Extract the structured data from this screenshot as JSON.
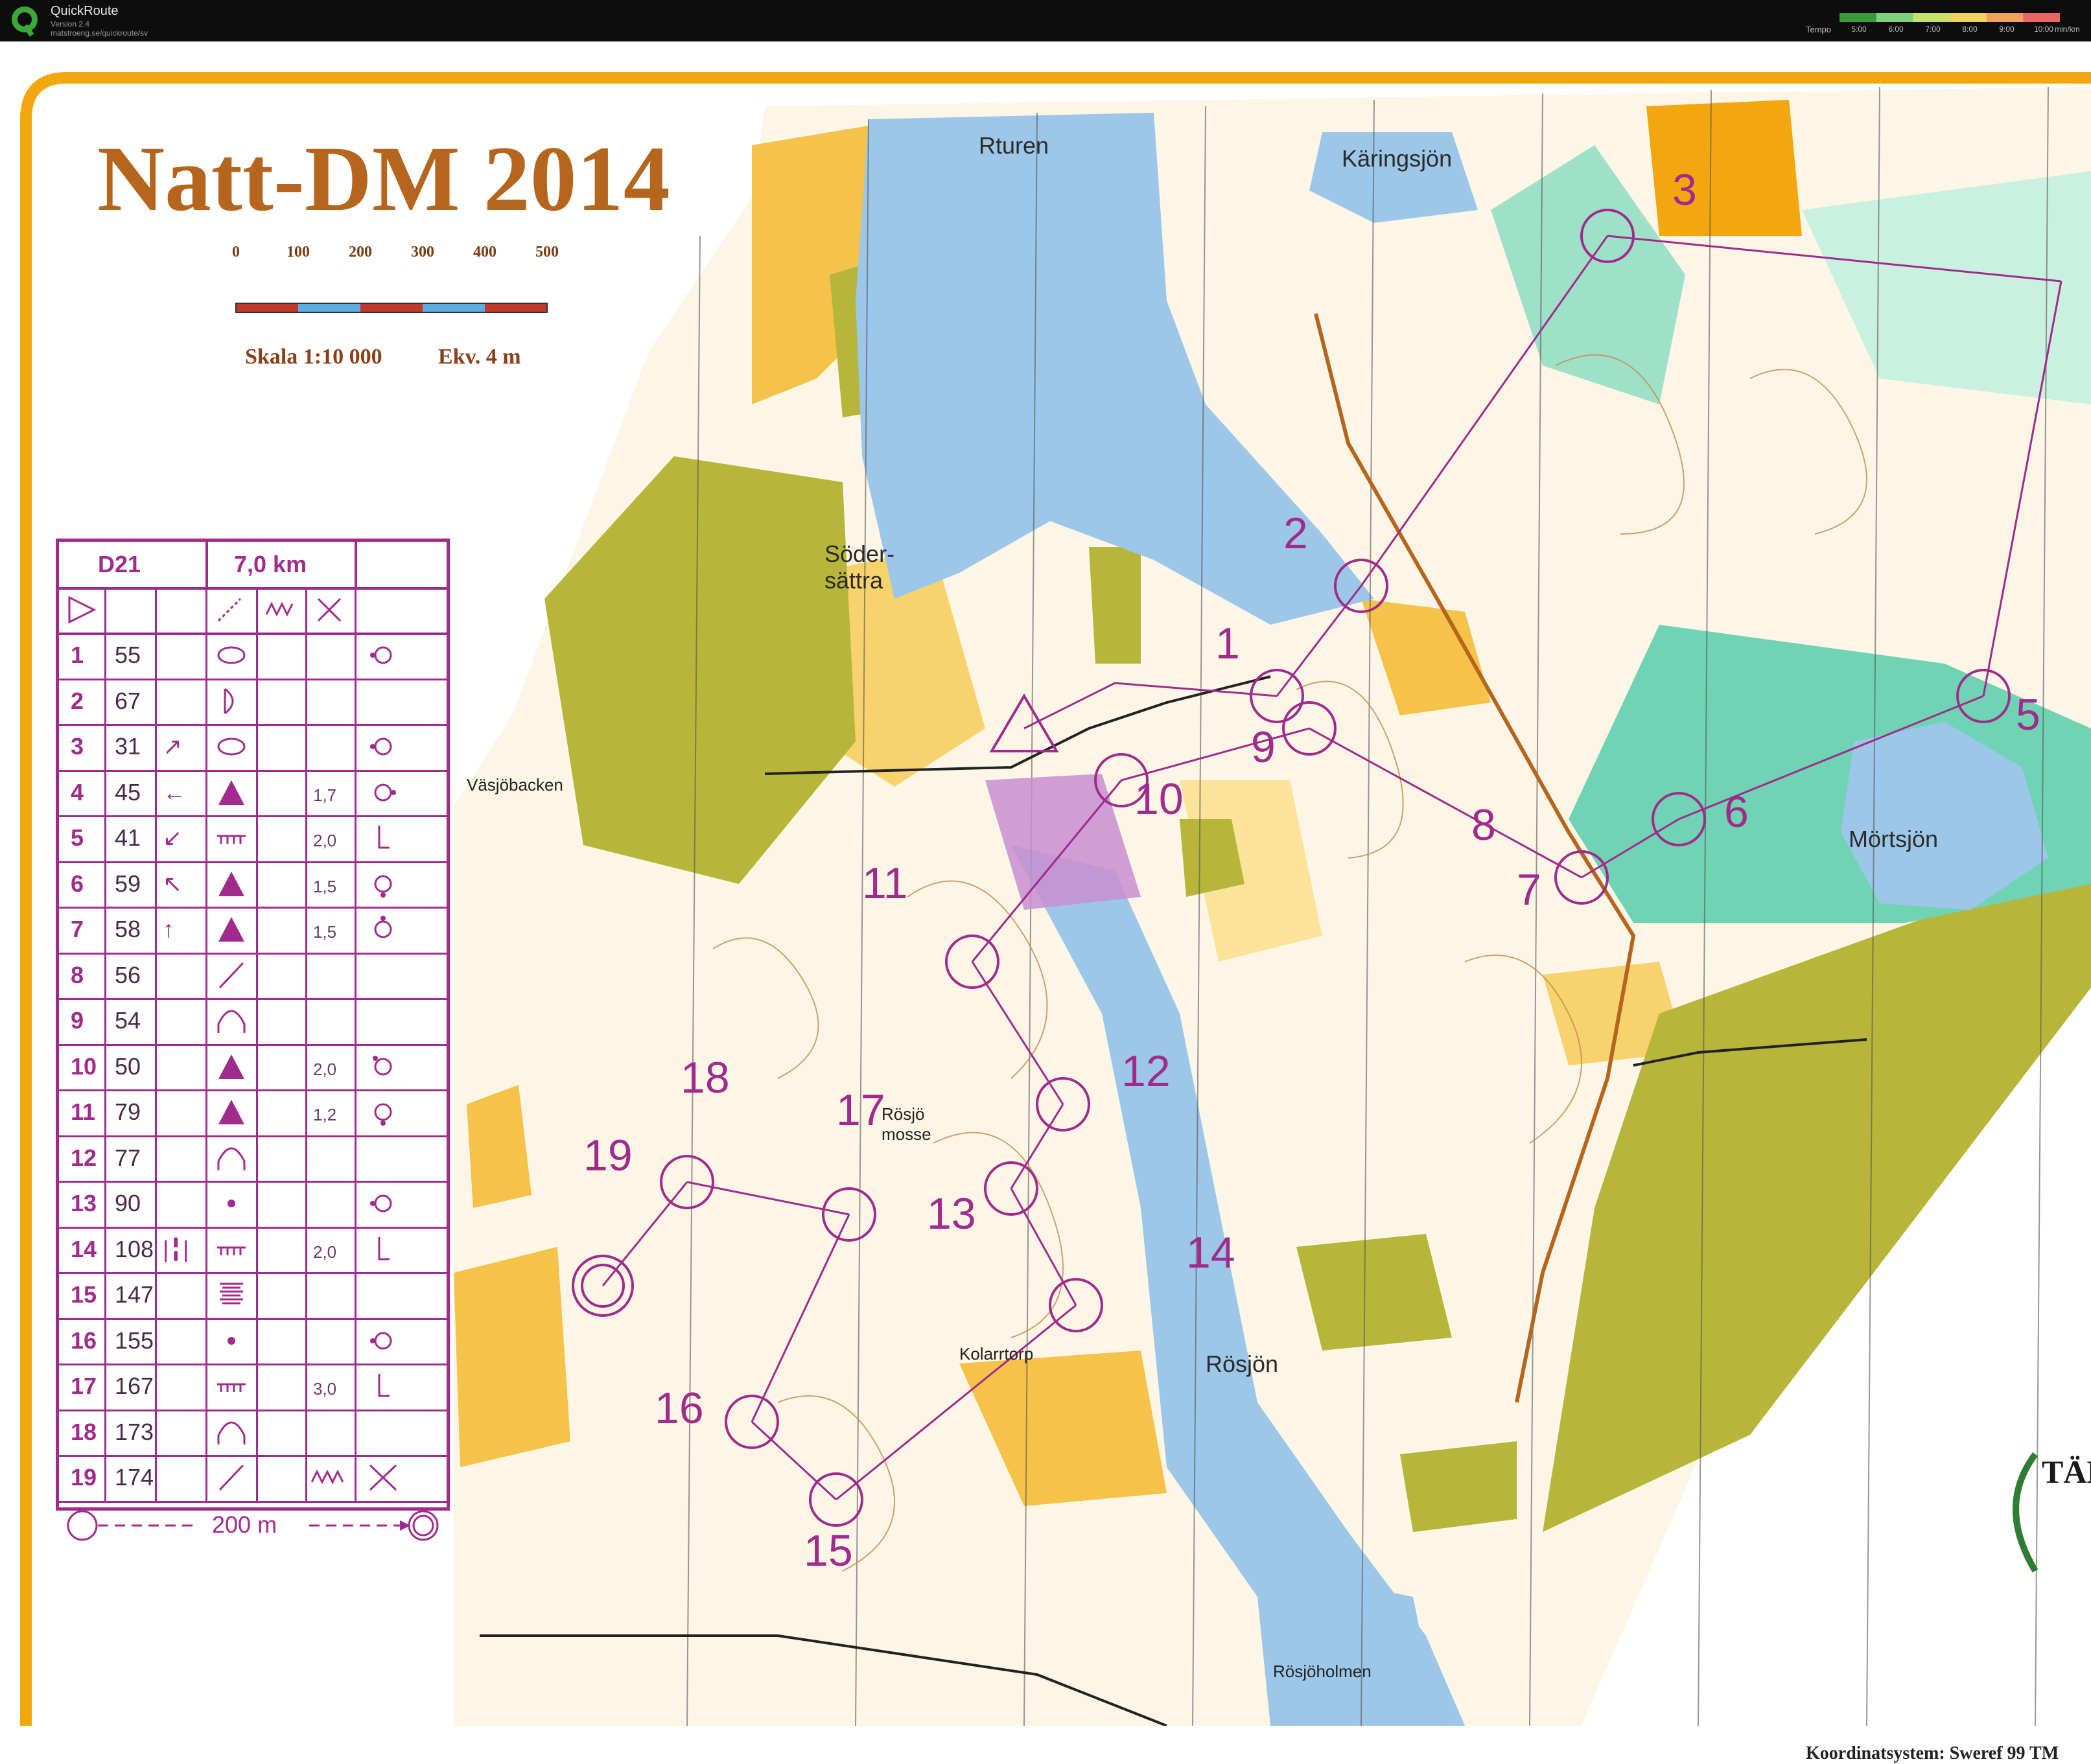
{
  "app": {
    "name": "QuickRoute",
    "version": "Version 2.4",
    "url": "matstroeng.se/quickroute/sv",
    "tempo_label": "Tempo",
    "tempo_ticks": [
      "5:00",
      "6:00",
      "7:00",
      "8:00",
      "9:00",
      "10:00"
    ],
    "tempo_unit": "min/km",
    "tempo_colors": [
      "#3a9b3a",
      "#7ed07e",
      "#c7e26a",
      "#f2d25e",
      "#f1a05a",
      "#e86565"
    ]
  },
  "map": {
    "title": "Natt-DM 2014",
    "scale_bar_labels": [
      "0",
      "100",
      "200",
      "300",
      "400",
      "500"
    ],
    "scale": "Skala 1:10 000",
    "equidistance": "Ekv. 4 m",
    "coordinate_system": "Koordinatsystem: Sweref 99 TM",
    "club_text": "TÄB",
    "place_names": {
      "rturen": "Rturen",
      "karingsjon": "Käringsjön",
      "sodersattra": "Söder-\nsättra",
      "vasjobacken": "Väsjöbacken",
      "mortsjon": "Mörtsjön",
      "rosjomosse": "Rösjö\nmosse",
      "kolarrtorp": "Kolarrtorp",
      "rosjon": "Rösjön",
      "rosjoholmen": "Rösjöholmen"
    },
    "control_labels": [
      "1",
      "2",
      "3",
      "5",
      "6",
      "7",
      "8",
      "9",
      "10",
      "11",
      "12",
      "13",
      "14",
      "15",
      "16",
      "17",
      "18",
      "19"
    ],
    "colors": {
      "water": "#9cc7e8",
      "open_land": "#f5c24a",
      "rough_open": "#fbe39a",
      "settlement": "#b7b53a",
      "marsh_green": "#59c9a8",
      "course_purple": "#a02b8c",
      "frame_orange": "#f2a70f",
      "contour_brown": "#c98b4a"
    }
  },
  "description_sheet": {
    "class": "D21",
    "length": "7,0 km",
    "header_icons": [
      "start-triangle-icon",
      "dashed-line-icon",
      "fence-zigzag-icon",
      "crossing-icon"
    ],
    "rows": [
      {
        "no": "1",
        "code": "55",
        "dir": "",
        "feature": "oval",
        "dim": "",
        "pos": "ring-left"
      },
      {
        "no": "2",
        "code": "67",
        "dir": "",
        "feature": "cliff-d",
        "dim": "",
        "pos": ""
      },
      {
        "no": "3",
        "code": "31",
        "dir": "↗",
        "feature": "oval",
        "dim": "",
        "pos": "ring-left"
      },
      {
        "no": "4",
        "code": "45",
        "dir": "←",
        "feature": "triangle",
        "dim": "1,7",
        "pos": "ring-right"
      },
      {
        "no": "5",
        "code": "41",
        "dir": "↙",
        "feature": "ditch",
        "dim": "2,0",
        "pos": "foot"
      },
      {
        "no": "6",
        "code": "59",
        "dir": "↖",
        "feature": "triangle",
        "dim": "1,5",
        "pos": "ring-bottom"
      },
      {
        "no": "7",
        "code": "58",
        "dir": "↑",
        "feature": "triangle",
        "dim": "1,5",
        "pos": "ring-top"
      },
      {
        "no": "8",
        "code": "56",
        "dir": "",
        "feature": "slash",
        "dim": "",
        "pos": ""
      },
      {
        "no": "9",
        "code": "54",
        "dir": "",
        "feature": "knoll",
        "dim": "",
        "pos": ""
      },
      {
        "no": "10",
        "code": "50",
        "dir": "",
        "feature": "triangle",
        "dim": "2,0",
        "pos": "ring-top-left"
      },
      {
        "no": "11",
        "code": "79",
        "dir": "",
        "feature": "triangle",
        "dim": "1,2",
        "pos": "ring-bottom"
      },
      {
        "no": "12",
        "code": "77",
        "dir": "",
        "feature": "knoll",
        "dim": "",
        "pos": ""
      },
      {
        "no": "13",
        "code": "90",
        "dir": "",
        "feature": "dot",
        "dim": "",
        "pos": "ring-left"
      },
      {
        "no": "14",
        "code": "108",
        "dir": "|╏|",
        "feature": "ditch",
        "dim": "2,0",
        "pos": "foot"
      },
      {
        "no": "15",
        "code": "147",
        "dir": "",
        "feature": "lines",
        "dim": "",
        "pos": ""
      },
      {
        "no": "16",
        "code": "155",
        "dir": "",
        "feature": "dot",
        "dim": "",
        "pos": "ring-left"
      },
      {
        "no": "17",
        "code": "167",
        "dir": "",
        "feature": "ditch",
        "dim": "3,0",
        "pos": "foot"
      },
      {
        "no": "18",
        "code": "173",
        "dir": "",
        "feature": "knoll",
        "dim": "",
        "pos": ""
      },
      {
        "no": "19",
        "code": "174",
        "dir": "",
        "feature": "slash",
        "dim": "zigzag",
        "pos": "cross"
      }
    ],
    "finish_text": "200 m"
  }
}
